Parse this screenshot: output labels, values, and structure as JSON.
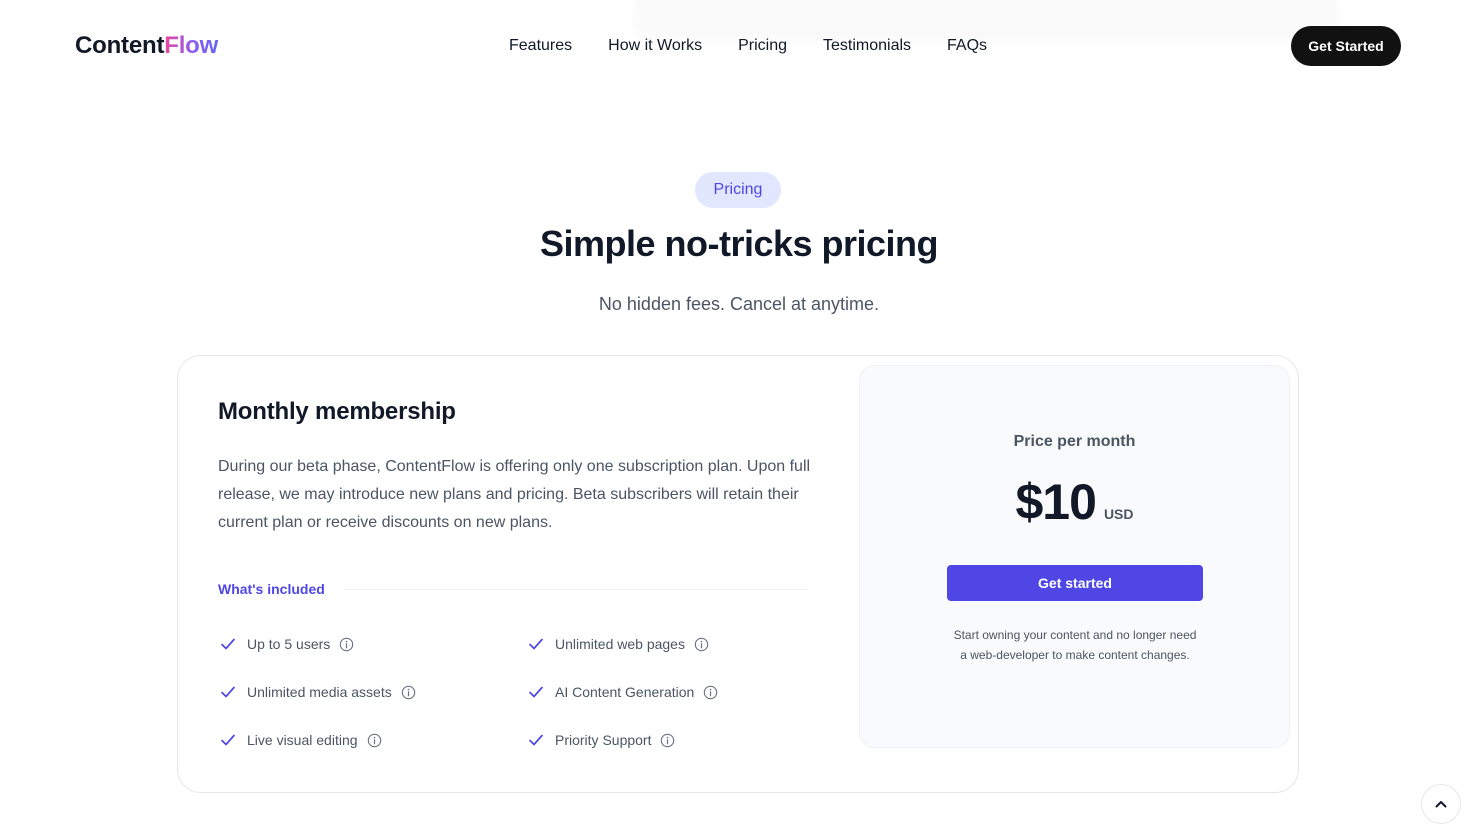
{
  "header": {
    "logo_primary": "Content",
    "logo_accent": "Flow",
    "nav": [
      "Features",
      "How it Works",
      "Pricing",
      "Testimonials",
      "FAQs"
    ],
    "cta_label": "Get Started"
  },
  "section": {
    "badge": "Pricing",
    "title": "Simple no-tricks pricing",
    "subtitle": "No hidden fees. Cancel at anytime."
  },
  "plan": {
    "title": "Monthly membership",
    "description": "During our beta phase, ContentFlow is offering only one subscription plan. Upon full release, we may introduce new plans and pricing. Beta subscribers will retain their current plan or receive discounts on new plans.",
    "included_label": "What's included",
    "features": [
      "Up to 5 users",
      "Unlimited web pages",
      "Unlimited media assets",
      "AI Content Generation",
      "Live visual editing",
      "Priority Support"
    ]
  },
  "price": {
    "label": "Price per month",
    "amount": "$10",
    "currency": "USD",
    "cta_label": "Get started",
    "note": "Start owning your content and no longer need a web-developer to make content changes."
  },
  "colors": {
    "accent": "#4f46e5",
    "badge_bg": "#e0e7ff",
    "dark": "#111827",
    "muted": "#4b5563"
  },
  "icons": {
    "check": "check-icon",
    "info": "info-icon",
    "scroll_top": "chevron-up-icon"
  }
}
